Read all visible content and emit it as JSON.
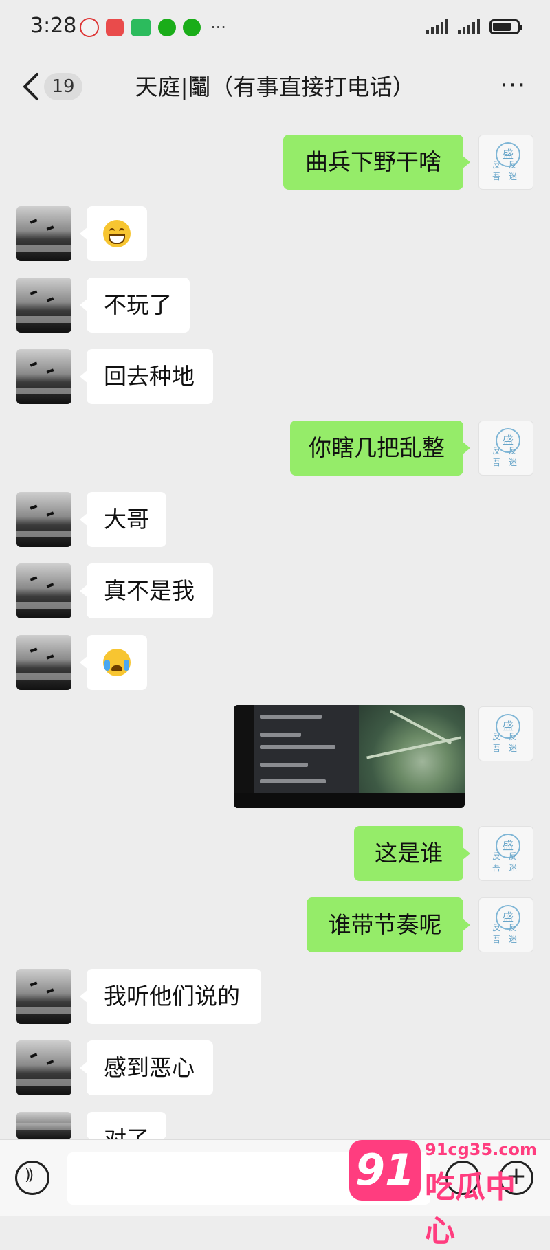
{
  "status_bar": {
    "time": "3:28",
    "icons": [
      "cat-app-icon",
      "red-app-icon",
      "green-app-icon",
      "wechat-icon",
      "wechat-icon"
    ],
    "more": "···",
    "battery_level": 0.75
  },
  "header": {
    "unread_count": "19",
    "title": "天庭|鬮（有事直接打电话）",
    "more": "···"
  },
  "messages": [
    {
      "side": "right",
      "type": "text",
      "text": "曲兵下野干啥"
    },
    {
      "side": "left",
      "type": "emoji",
      "emoji": "grin-emoji"
    },
    {
      "side": "left",
      "type": "text",
      "text": "不玩了"
    },
    {
      "side": "left",
      "type": "text",
      "text": "回去种地"
    },
    {
      "side": "right",
      "type": "text",
      "text": "你瞎几把乱整"
    },
    {
      "side": "left",
      "type": "text",
      "text": "大哥"
    },
    {
      "side": "left",
      "type": "text",
      "text": "真不是我"
    },
    {
      "side": "left",
      "type": "emoji",
      "emoji": "crying-emoji"
    },
    {
      "side": "right",
      "type": "image",
      "image": "game-screenshot"
    },
    {
      "side": "right",
      "type": "text",
      "text": "这是谁"
    },
    {
      "side": "right",
      "type": "text",
      "text": "谁带节奏呢"
    },
    {
      "side": "left",
      "type": "text",
      "text": "我听他们说的"
    },
    {
      "side": "left",
      "type": "text",
      "text": "感到恶心"
    },
    {
      "side": "left",
      "type": "text",
      "text": "对了"
    }
  ],
  "self_avatar": {
    "seal": "盛",
    "signature": "反 反 吾 迷"
  },
  "watermark": {
    "number": "91",
    "url": "91cg35.com",
    "name": "吃瓜中心"
  },
  "colors": {
    "right_bubble": "#95ec69",
    "left_bubble": "#ffffff",
    "background": "#ededed",
    "watermark": "#ff3d7f"
  }
}
